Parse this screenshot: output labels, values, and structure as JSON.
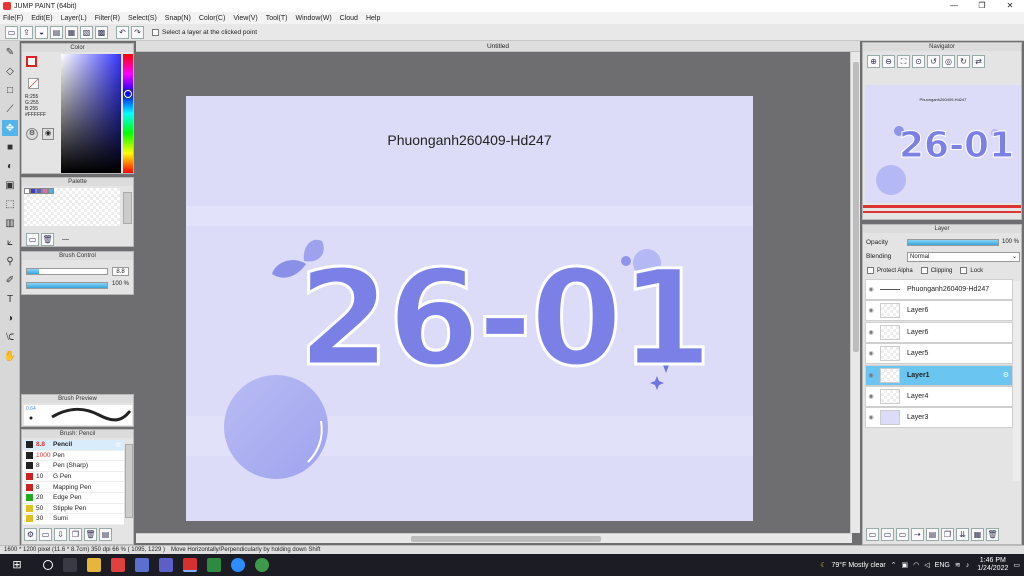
{
  "window": {
    "title": "JUMP PAINT (64bit)",
    "controls": [
      "—",
      "❐",
      "✕"
    ]
  },
  "menu": [
    "File(F)",
    "Edit(E)",
    "Layer(L)",
    "Filter(R)",
    "Select(S)",
    "Snap(N)",
    "Color(C)",
    "View(V)",
    "Tool(T)",
    "Window(W)",
    "Cloud",
    "Help"
  ],
  "toolbar": {
    "select_layer_label": "Select a layer at the clicked point"
  },
  "color_panel": {
    "title": "Color",
    "r": "R:255",
    "g": "G:255",
    "b": "B:255",
    "hex": "#FFFFFF",
    "accent": "#52b4e8"
  },
  "palette_panel": {
    "title": "Palette",
    "colors": [
      "#ffffff",
      "#3b3bd0",
      "#6060c0",
      "#e070a0",
      "#4ab0e8"
    ],
    "dash": "—"
  },
  "brush_control": {
    "title": "Brush Control",
    "size": "8.8",
    "opacity": "100 %",
    "opacity_fraction": 1.0
  },
  "brush_preview": {
    "title": "Brush Preview",
    "size_label": "0.64"
  },
  "brush_panel": {
    "title": "Brush: Pencil",
    "items": [
      {
        "size": "8.8",
        "name": "Pencil",
        "color": "#222222"
      },
      {
        "size": "1000",
        "name": "Pen",
        "color": "#222222"
      },
      {
        "size": "8",
        "name": "Pen (Sharp)",
        "color": "#222222"
      },
      {
        "size": "10",
        "name": "G Pen",
        "color": "#cc2222"
      },
      {
        "size": "8",
        "name": "Mapping Pen",
        "color": "#cc2222"
      },
      {
        "size": "20",
        "name": "Edge Pen",
        "color": "#22aa22"
      },
      {
        "size": "50",
        "name": "Stipple Pen",
        "color": "#e0c020"
      },
      {
        "size": "30",
        "name": "Sumi",
        "color": "#e0c020"
      }
    ]
  },
  "canvas": {
    "tab_title": "Untitled",
    "artwork_title": "Phuonganh260409-Hd247",
    "artwork_text": "26-01",
    "bg_color": "#dcdcf8",
    "ink_color": "#7b80e6"
  },
  "navigator": {
    "title": "Navigator",
    "thumb_title": "Phuonganh260409-Hd247",
    "thumb_text": "26-01"
  },
  "layer_panel": {
    "title": "Layer",
    "opacity_label": "Opacity",
    "opacity_value": "100 %",
    "opacity_fraction": 1.0,
    "blending_label": "Blending",
    "blending_value": "Normal",
    "protect_alpha": "Protect Alpha",
    "clipping": "Clipping",
    "lock": "Lock",
    "layers": [
      {
        "name": "Phuonganh260409-Hd247",
        "selected": false
      },
      {
        "name": "Layer6",
        "selected": false
      },
      {
        "name": "Layer6",
        "selected": false
      },
      {
        "name": "Layer5",
        "selected": false
      },
      {
        "name": "Layer1",
        "selected": true
      },
      {
        "name": "Layer4",
        "selected": false
      },
      {
        "name": "Layer3",
        "selected": false
      }
    ]
  },
  "statusbar": {
    "dimensions": "1600 * 1200 pixel  (11.6 * 8.7cm)  350 dpi  66 %  ( 1095, 1229 )",
    "hint": "Move Horizontally/Perpendicularly by holding down Shift"
  },
  "taskbar": {
    "weather": "79°F  Mostly clear",
    "lang": "ENG",
    "time": "1:46 PM",
    "date": "1/24/2022"
  }
}
